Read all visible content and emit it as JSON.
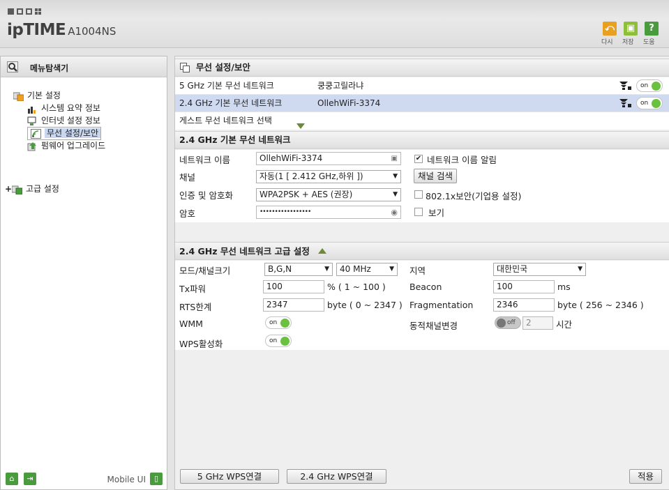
{
  "header": {
    "brand": "ipTIME",
    "model": "A1004NS",
    "buttons": {
      "reload_label": "다시",
      "save_label": "저장",
      "help_label": "도움"
    }
  },
  "sidebar": {
    "title": "메뉴탐색기",
    "basic_group": "기본 설정",
    "items": [
      {
        "label": "시스템 요약 정보"
      },
      {
        "label": "인터넷 설정 정보"
      },
      {
        "label": "무선 설정/보안"
      },
      {
        "label": "펌웨어 업그레이드"
      }
    ],
    "advanced_group": "고급 설정",
    "mobile_ui": "Mobile UI"
  },
  "main": {
    "title": "무선 설정/보안",
    "networks": [
      {
        "band_label": "5 GHz 기본 무선 네트워크",
        "ssid": "쿵쿵고릴라냐",
        "toggle": "on"
      },
      {
        "band_label": "2.4 GHz 기본 무선 네트워크",
        "ssid": "OllehWiFi-3374",
        "toggle": "on"
      }
    ],
    "guest_label": "게스트 무선 네트워크 선택",
    "basic": {
      "title": "2.4 GHz 기본 무선 네트워크",
      "name_label": "네트워크 이름",
      "name_value": "OllehWiFi-3374",
      "broadcast_label": "네트워크 이름 알림",
      "channel_label": "채널",
      "channel_value": "자동(1 [ 2.412 GHz,하위 ])",
      "channel_scan_button": "채널 검색",
      "auth_label": "인증 및 암호화",
      "auth_value": "WPA2PSK + AES (권장)",
      "dot1x_label": "802.1x보안(기업용 설정)",
      "password_label": "암호",
      "password_value": "•••••••••••••••••",
      "show_label": "보기"
    },
    "advanced": {
      "title": "2.4 GHz 무선 네트워크 고급 설정",
      "mode_label": "모드/채널크기",
      "mode_value": "B,G,N",
      "width_value": "40 MHz",
      "region_label": "지역",
      "region_value": "대한민국",
      "tx_label": "Tx파워",
      "tx_value": "100",
      "tx_unit": "% ( 1 ~ 100 )",
      "beacon_label": "Beacon",
      "beacon_value": "100",
      "beacon_unit": "ms",
      "rts_label": "RTS한계",
      "rts_value": "2347",
      "rts_unit": "byte ( 0 ~ 2347 )",
      "frag_label": "Fragmentation",
      "frag_value": "2346",
      "frag_unit": "byte ( 256 ~ 2346 )",
      "wmm_label": "WMM",
      "wmm_toggle": "on",
      "dyn_label": "동적채널변경",
      "dyn_toggle": "off",
      "dyn_value": "2",
      "dyn_unit": "시간",
      "wps_label": "WPS활성화",
      "wps_toggle": "on"
    },
    "footer": {
      "wps5_button": "5 GHz WPS연결",
      "wps24_button": "2.4 GHz WPS연결",
      "apply_button": "적용"
    }
  },
  "colors": {
    "toggle_on": "#6ac03f",
    "highlight_row": "#cfdaf0",
    "accent_green": "#6d8a3a",
    "icon_orange": "#e8a020",
    "icon_green": "#4a9a3e"
  }
}
